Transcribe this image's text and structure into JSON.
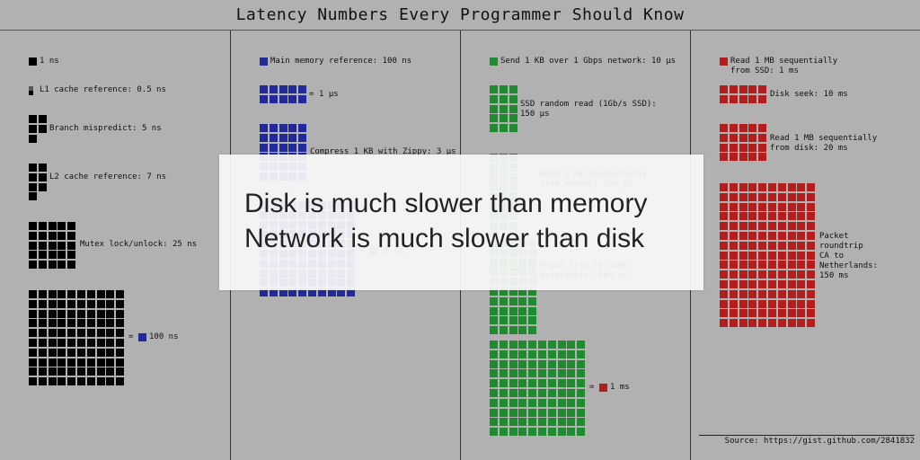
{
  "title": "Latency Numbers Every Programmer Should Know",
  "colors": {
    "black": "#000000",
    "grey": "#5a5a5a",
    "blue": "#22299a",
    "green": "#1e8b2f",
    "red": "#b51c1c",
    "background": "#b1b1b1"
  },
  "columns": [
    {
      "items": [
        {
          "label": "1 ns"
        },
        {
          "label": "L1 cache reference: 0.5 ns"
        },
        {
          "label": "Branch mispredict: 5 ns"
        },
        {
          "label": "L2 cache reference: 7 ns"
        },
        {
          "label": "Mutex lock/unlock: 25 ns"
        },
        {
          "label": "100 ns"
        }
      ]
    },
    {
      "items": [
        {
          "label": "Main memory reference: 100 ns"
        },
        {
          "label": "1 µs"
        },
        {
          "label": "Compress 1 KB with Zippy: 3 µs"
        },
        {
          "label": "Read 1 MB sequentially\nfrom memory: 250 µs"
        },
        {
          "label": "10 µs"
        }
      ]
    },
    {
      "items": [
        {
          "label": "Send 1 KB over 1 Gbps network: 10 µs"
        },
        {
          "label": "SSD random read (1Gb/s SSD):\n150 µs"
        },
        {
          "label": "Read 1 MB sequentially\nfrom memory: 250 µs"
        },
        {
          "label": "Round trip in same\ndatacenter: 500 µs"
        },
        {
          "label": "1 ms"
        }
      ]
    },
    {
      "items": [
        {
          "label": "Read 1 MB sequentially\nfrom SSD: 1 ms"
        },
        {
          "label": "Disk seek: 10 ms"
        },
        {
          "label": "Read 1 MB sequentially\nfrom disk: 20 ms"
        },
        {
          "label": "Packet\nroundtrip\nCA to\nNetherlands:\n150 ms"
        }
      ]
    }
  ],
  "equals": "=",
  "overlay": {
    "line1": "Disk is much slower than memory",
    "line2": "Network is much slower than disk"
  },
  "source": "Source: https://gist.github.com/2841832"
}
